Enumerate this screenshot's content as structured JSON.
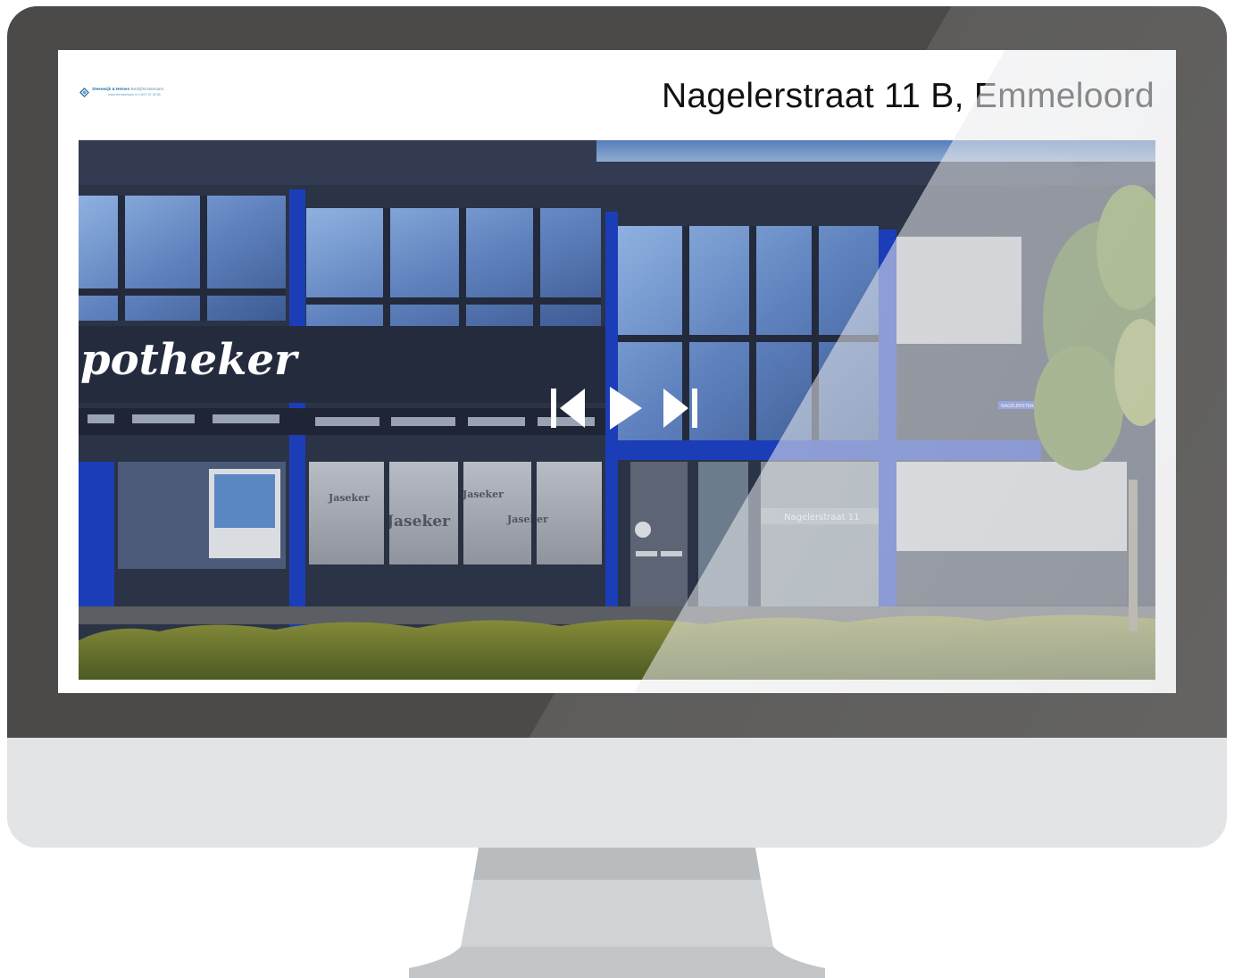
{
  "slide": {
    "title": "Nagelerstraat 11 B, Emmeloord"
  },
  "logo": {
    "name": "Steenwijk & Heinen",
    "name_suffix": "Bedrijfsmakelaars",
    "sub": "www.shmakelaars.nl  |  0527 61 38 68"
  },
  "photo": {
    "sign_text": "potheker",
    "window_text": "Jaseker",
    "door_text": "Nagelerstraat 11",
    "street_sign": "NAGELERSTRAAT"
  },
  "controls": {
    "previous_icon": "skip-previous-icon",
    "play_icon": "play-icon",
    "next_icon": "skip-next-icon"
  },
  "colors": {
    "bezel": "#4b4a48",
    "chin": "#e3e4e6",
    "stand": "#cdd0d2",
    "facade_blue": "#1c3db8",
    "facade_dark": "#2b3346"
  }
}
